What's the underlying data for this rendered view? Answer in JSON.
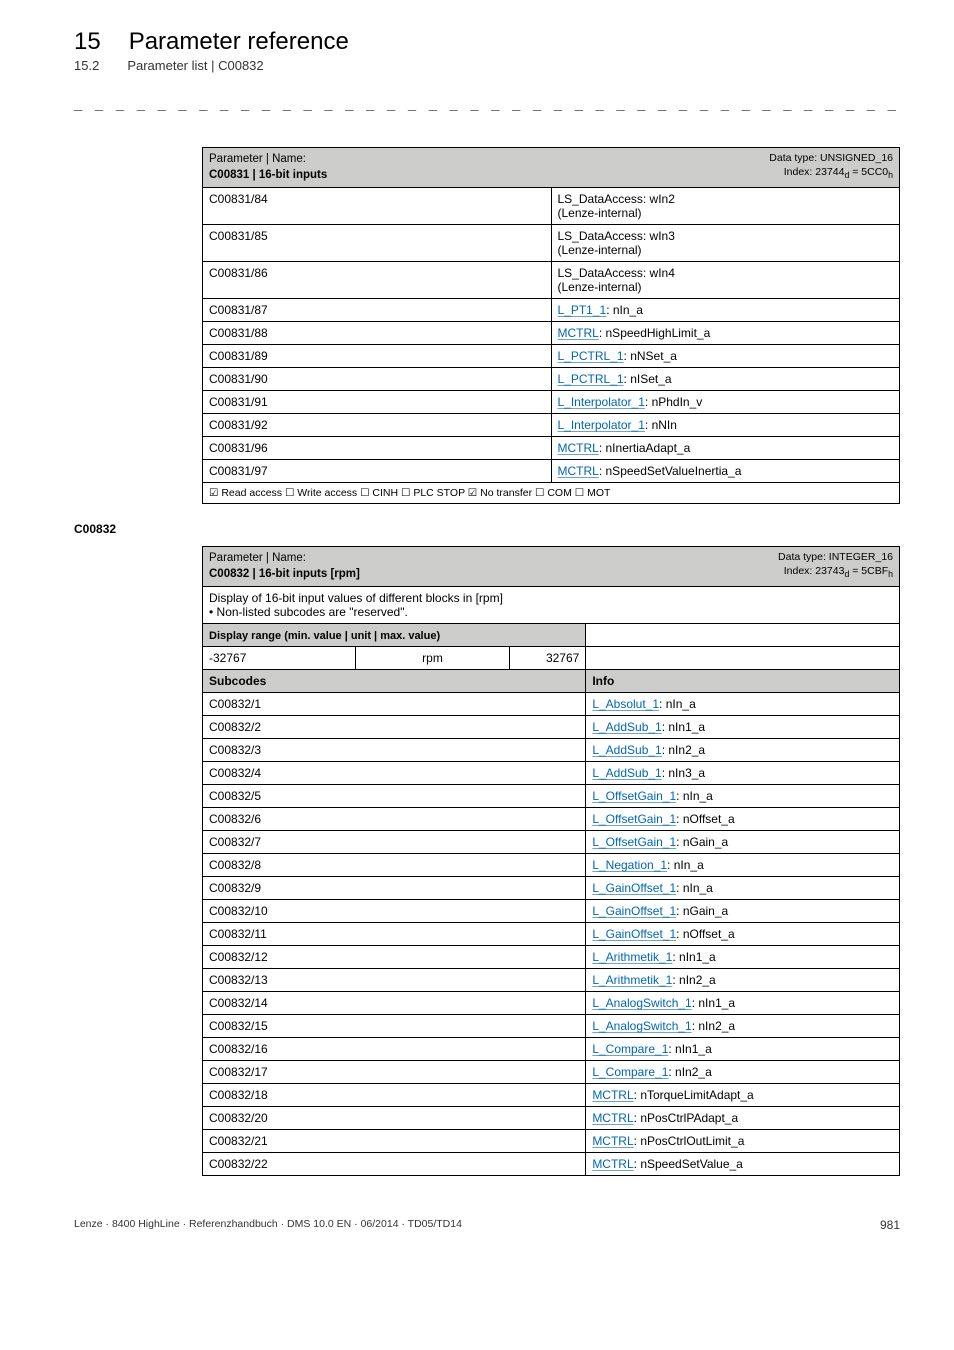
{
  "header": {
    "chapter_num": "15",
    "chapter_title": "Parameter reference",
    "sub_num": "15.2",
    "sub_title": "Parameter list | C00832"
  },
  "dashes": "_ _ _ _ _ _ _ _ _ _ _ _ _ _ _ _ _ _ _ _ _ _ _ _ _ _ _ _ _ _ _ _ _ _ _ _ _ _ _ _ _ _ _ _ _ _ _ _ _ _ _ _ _ _ _ _ _ _ _ _ _ _",
  "table1": {
    "hdr_left_line1": "Parameter | Name:",
    "hdr_left_line2": "C00831 | 16-bit inputs",
    "hdr_right_line1": "Data type: UNSIGNED_16",
    "hdr_right_line2_a": "Index: 23744",
    "hdr_right_line2_b": " = 5CC0",
    "rows": [
      {
        "code": "C00831/84",
        "val_pre": "",
        "val_link": "",
        "val_post": "LS_DataAccess: wIn2\n(Lenze-internal)"
      },
      {
        "code": "C00831/85",
        "val_pre": "",
        "val_link": "",
        "val_post": "LS_DataAccess: wIn3\n(Lenze-internal)"
      },
      {
        "code": "C00831/86",
        "val_pre": "",
        "val_link": "",
        "val_post": "LS_DataAccess: wIn4\n(Lenze-internal)"
      },
      {
        "code": "C00831/87",
        "val_link": "L_PT1_1",
        "val_post": ": nIn_a"
      },
      {
        "code": "C00831/88",
        "val_link": "MCTRL",
        "val_post": ": nSpeedHighLimit_a"
      },
      {
        "code": "C00831/89",
        "val_link": "L_PCTRL_1",
        "val_post": ": nNSet_a"
      },
      {
        "code": "C00831/90",
        "val_link": "L_PCTRL_1",
        "val_post": ": nISet_a"
      },
      {
        "code": "C00831/91",
        "val_link": "L_Interpolator_1",
        "val_post": ": nPhdIn_v"
      },
      {
        "code": "C00831/92",
        "val_link": "L_Interpolator_1",
        "val_post": ": nNIn"
      },
      {
        "code": "C00831/96",
        "val_link": "MCTRL",
        "val_post": ": nInertiaAdapt_a"
      },
      {
        "code": "C00831/97",
        "val_link": "MCTRL",
        "val_post": ": nSpeedSetValueInertia_a"
      }
    ],
    "footer": "☑ Read access   ☐ Write access   ☐ CINH   ☐ PLC STOP   ☑ No transfer   ☐ COM   ☐ MOT"
  },
  "anchor2": "C00832",
  "table2": {
    "hdr_left_line1": "Parameter | Name:",
    "hdr_left_line2": "C00832 | 16-bit inputs [rpm]",
    "hdr_right_line1": "Data type: INTEGER_16",
    "hdr_right_line2_a": "Index: 23743",
    "hdr_right_line2_b": " = 5CBF",
    "desc_line1": "Display of 16-bit input values of different blocks in [rpm]",
    "desc_bullet": " • Non-listed subcodes are \"reserved\".",
    "range_label": "Display range (min. value | unit | max. value)",
    "range_min": "-32767",
    "range_unit": "rpm",
    "range_max": "32767",
    "subcodes_hdr": "Subcodes",
    "info_hdr": "Info",
    "rows": [
      {
        "code": "C00832/1",
        "val_link": "L_Absolut_1",
        "val_post": ": nIn_a"
      },
      {
        "code": "C00832/2",
        "val_link": "L_AddSub_1",
        "val_post": ": nIn1_a"
      },
      {
        "code": "C00832/3",
        "val_link": "L_AddSub_1",
        "val_post": ": nIn2_a"
      },
      {
        "code": "C00832/4",
        "val_link": "L_AddSub_1",
        "val_post": ": nIn3_a"
      },
      {
        "code": "C00832/5",
        "val_link": "L_OffsetGain_1",
        "val_post": ": nIn_a"
      },
      {
        "code": "C00832/6",
        "val_link": "L_OffsetGain_1",
        "val_post": ": nOffset_a"
      },
      {
        "code": "C00832/7",
        "val_link": "L_OffsetGain_1",
        "val_post": ": nGain_a"
      },
      {
        "code": "C00832/8",
        "val_link": "L_Negation_1",
        "val_post": ": nIn_a"
      },
      {
        "code": "C00832/9",
        "val_link": "L_GainOffset_1",
        "val_post": ": nIn_a"
      },
      {
        "code": "C00832/10",
        "val_link": "L_GainOffset_1",
        "val_post": ": nGain_a"
      },
      {
        "code": "C00832/11",
        "val_link": "L_GainOffset_1",
        "val_post": ": nOffset_a"
      },
      {
        "code": "C00832/12",
        "val_link": "L_Arithmetik_1",
        "val_post": ": nIn1_a"
      },
      {
        "code": "C00832/13",
        "val_link": "L_Arithmetik_1",
        "val_post": ": nIn2_a"
      },
      {
        "code": "C00832/14",
        "val_link": "L_AnalogSwitch_1",
        "val_post": ": nIn1_a"
      },
      {
        "code": "C00832/15",
        "val_link": "L_AnalogSwitch_1",
        "val_post": ": nIn2_a"
      },
      {
        "code": "C00832/16",
        "val_link": "L_Compare_1",
        "val_post": ": nIn1_a"
      },
      {
        "code": "C00832/17",
        "val_link": "L_Compare_1",
        "val_post": ": nIn2_a"
      },
      {
        "code": "C00832/18",
        "val_link": "MCTRL",
        "val_post": ": nTorqueLimitAdapt_a"
      },
      {
        "code": "C00832/20",
        "val_link": "MCTRL",
        "val_post": ": nPosCtrlPAdapt_a"
      },
      {
        "code": "C00832/21",
        "val_link": "MCTRL",
        "val_post": ": nPosCtrlOutLimit_a"
      },
      {
        "code": "C00832/22",
        "val_link": "MCTRL",
        "val_post": ": nSpeedSetValue_a"
      }
    ]
  },
  "footer": {
    "left": "Lenze · 8400 HighLine · Referenzhandbuch · DMS 10.0 EN · 06/2014 · TD05/TD14",
    "right": "981"
  }
}
